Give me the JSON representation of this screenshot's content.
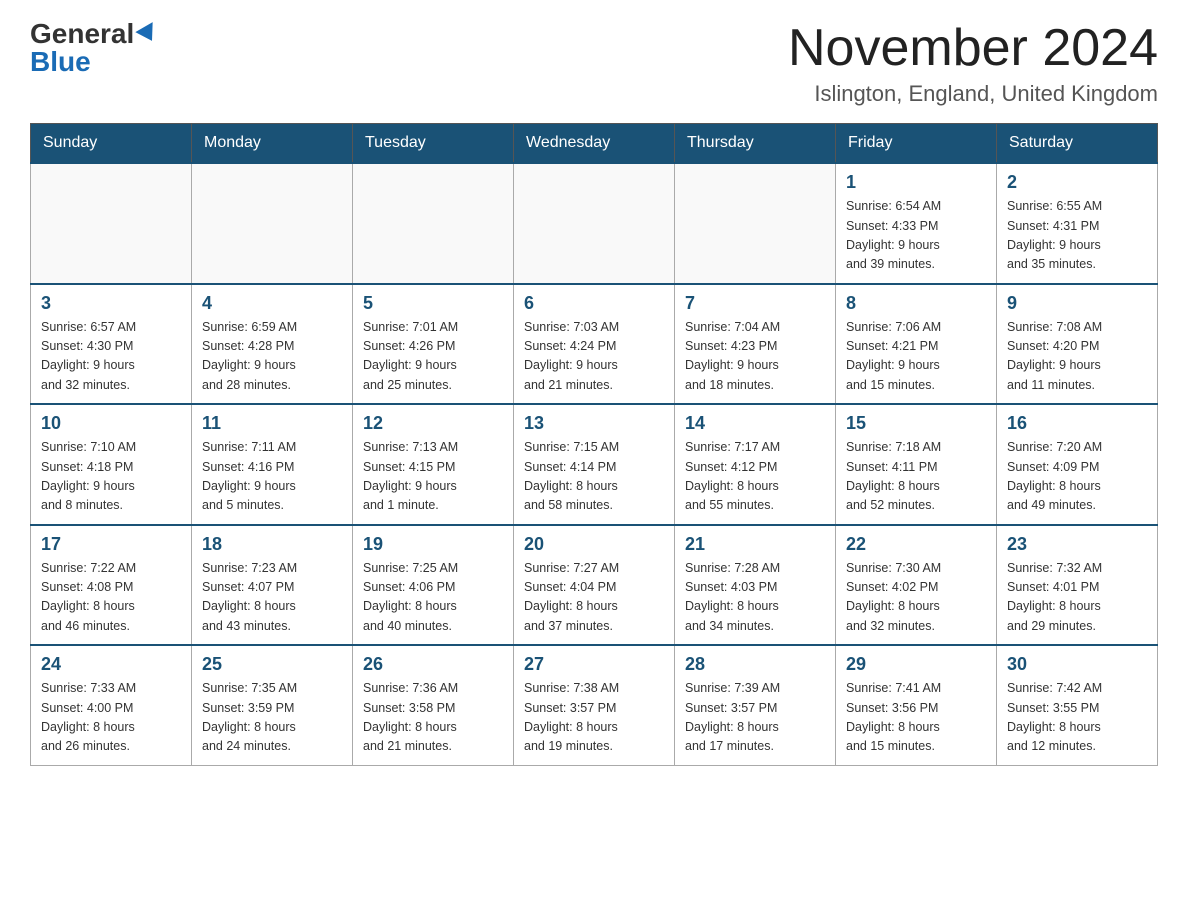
{
  "header": {
    "logo_general": "General",
    "logo_blue": "Blue",
    "month_title": "November 2024",
    "location": "Islington, England, United Kingdom"
  },
  "weekdays": [
    "Sunday",
    "Monday",
    "Tuesday",
    "Wednesday",
    "Thursday",
    "Friday",
    "Saturday"
  ],
  "weeks": [
    [
      {
        "day": "",
        "info": ""
      },
      {
        "day": "",
        "info": ""
      },
      {
        "day": "",
        "info": ""
      },
      {
        "day": "",
        "info": ""
      },
      {
        "day": "",
        "info": ""
      },
      {
        "day": "1",
        "info": "Sunrise: 6:54 AM\nSunset: 4:33 PM\nDaylight: 9 hours\nand 39 minutes."
      },
      {
        "day": "2",
        "info": "Sunrise: 6:55 AM\nSunset: 4:31 PM\nDaylight: 9 hours\nand 35 minutes."
      }
    ],
    [
      {
        "day": "3",
        "info": "Sunrise: 6:57 AM\nSunset: 4:30 PM\nDaylight: 9 hours\nand 32 minutes."
      },
      {
        "day": "4",
        "info": "Sunrise: 6:59 AM\nSunset: 4:28 PM\nDaylight: 9 hours\nand 28 minutes."
      },
      {
        "day": "5",
        "info": "Sunrise: 7:01 AM\nSunset: 4:26 PM\nDaylight: 9 hours\nand 25 minutes."
      },
      {
        "day": "6",
        "info": "Sunrise: 7:03 AM\nSunset: 4:24 PM\nDaylight: 9 hours\nand 21 minutes."
      },
      {
        "day": "7",
        "info": "Sunrise: 7:04 AM\nSunset: 4:23 PM\nDaylight: 9 hours\nand 18 minutes."
      },
      {
        "day": "8",
        "info": "Sunrise: 7:06 AM\nSunset: 4:21 PM\nDaylight: 9 hours\nand 15 minutes."
      },
      {
        "day": "9",
        "info": "Sunrise: 7:08 AM\nSunset: 4:20 PM\nDaylight: 9 hours\nand 11 minutes."
      }
    ],
    [
      {
        "day": "10",
        "info": "Sunrise: 7:10 AM\nSunset: 4:18 PM\nDaylight: 9 hours\nand 8 minutes."
      },
      {
        "day": "11",
        "info": "Sunrise: 7:11 AM\nSunset: 4:16 PM\nDaylight: 9 hours\nand 5 minutes."
      },
      {
        "day": "12",
        "info": "Sunrise: 7:13 AM\nSunset: 4:15 PM\nDaylight: 9 hours\nand 1 minute."
      },
      {
        "day": "13",
        "info": "Sunrise: 7:15 AM\nSunset: 4:14 PM\nDaylight: 8 hours\nand 58 minutes."
      },
      {
        "day": "14",
        "info": "Sunrise: 7:17 AM\nSunset: 4:12 PM\nDaylight: 8 hours\nand 55 minutes."
      },
      {
        "day": "15",
        "info": "Sunrise: 7:18 AM\nSunset: 4:11 PM\nDaylight: 8 hours\nand 52 minutes."
      },
      {
        "day": "16",
        "info": "Sunrise: 7:20 AM\nSunset: 4:09 PM\nDaylight: 8 hours\nand 49 minutes."
      }
    ],
    [
      {
        "day": "17",
        "info": "Sunrise: 7:22 AM\nSunset: 4:08 PM\nDaylight: 8 hours\nand 46 minutes."
      },
      {
        "day": "18",
        "info": "Sunrise: 7:23 AM\nSunset: 4:07 PM\nDaylight: 8 hours\nand 43 minutes."
      },
      {
        "day": "19",
        "info": "Sunrise: 7:25 AM\nSunset: 4:06 PM\nDaylight: 8 hours\nand 40 minutes."
      },
      {
        "day": "20",
        "info": "Sunrise: 7:27 AM\nSunset: 4:04 PM\nDaylight: 8 hours\nand 37 minutes."
      },
      {
        "day": "21",
        "info": "Sunrise: 7:28 AM\nSunset: 4:03 PM\nDaylight: 8 hours\nand 34 minutes."
      },
      {
        "day": "22",
        "info": "Sunrise: 7:30 AM\nSunset: 4:02 PM\nDaylight: 8 hours\nand 32 minutes."
      },
      {
        "day": "23",
        "info": "Sunrise: 7:32 AM\nSunset: 4:01 PM\nDaylight: 8 hours\nand 29 minutes."
      }
    ],
    [
      {
        "day": "24",
        "info": "Sunrise: 7:33 AM\nSunset: 4:00 PM\nDaylight: 8 hours\nand 26 minutes."
      },
      {
        "day": "25",
        "info": "Sunrise: 7:35 AM\nSunset: 3:59 PM\nDaylight: 8 hours\nand 24 minutes."
      },
      {
        "day": "26",
        "info": "Sunrise: 7:36 AM\nSunset: 3:58 PM\nDaylight: 8 hours\nand 21 minutes."
      },
      {
        "day": "27",
        "info": "Sunrise: 7:38 AM\nSunset: 3:57 PM\nDaylight: 8 hours\nand 19 minutes."
      },
      {
        "day": "28",
        "info": "Sunrise: 7:39 AM\nSunset: 3:57 PM\nDaylight: 8 hours\nand 17 minutes."
      },
      {
        "day": "29",
        "info": "Sunrise: 7:41 AM\nSunset: 3:56 PM\nDaylight: 8 hours\nand 15 minutes."
      },
      {
        "day": "30",
        "info": "Sunrise: 7:42 AM\nSunset: 3:55 PM\nDaylight: 8 hours\nand 12 minutes."
      }
    ]
  ]
}
